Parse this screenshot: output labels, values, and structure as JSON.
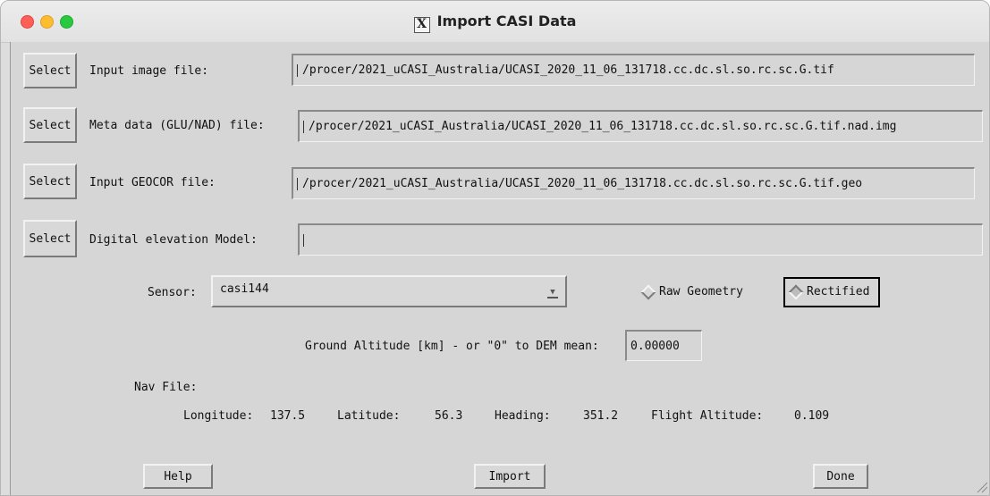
{
  "window": {
    "title": "Import CASI Data",
    "title_icon": "x11-icon"
  },
  "rows": [
    {
      "button": "Select",
      "label": "Input image file:",
      "value": "/procer/2021_uCASI_Australia/UCASI_2020_11_06_131718.cc.dc.sl.so.rc.sc.G.tif"
    },
    {
      "button": "Select",
      "label": "Meta data (GLU/NAD) file:",
      "value": "/procer/2021_uCASI_Australia/UCASI_2020_11_06_131718.cc.dc.sl.so.rc.sc.G.tif.nad.img"
    },
    {
      "button": "Select",
      "label": "Input GEOCOR file:",
      "value": "/procer/2021_uCASI_Australia/UCASI_2020_11_06_131718.cc.dc.sl.so.rc.sc.G.tif.geo"
    },
    {
      "button": "Select",
      "label": "Digital elevation Model:",
      "value": ""
    }
  ],
  "sensor": {
    "label": "Sensor:",
    "value": "casi144"
  },
  "geometry": {
    "option1": "Raw Geometry",
    "option2": "Rectified",
    "selected": "Rectified"
  },
  "altitude": {
    "label": "Ground Altitude [km] - or \"0\" to DEM mean:",
    "value": "0.00000"
  },
  "nav": {
    "title": "Nav File:",
    "longitude_label": "Longitude:",
    "longitude": "137.5",
    "latitude_label": "Latitude:",
    "latitude": "56.3",
    "heading_label": "Heading:",
    "heading": "351.2",
    "flight_alt_label": "Flight Altitude:",
    "flight_alt": "0.109"
  },
  "buttons": {
    "help": "Help",
    "import": "Import",
    "done": "Done"
  }
}
